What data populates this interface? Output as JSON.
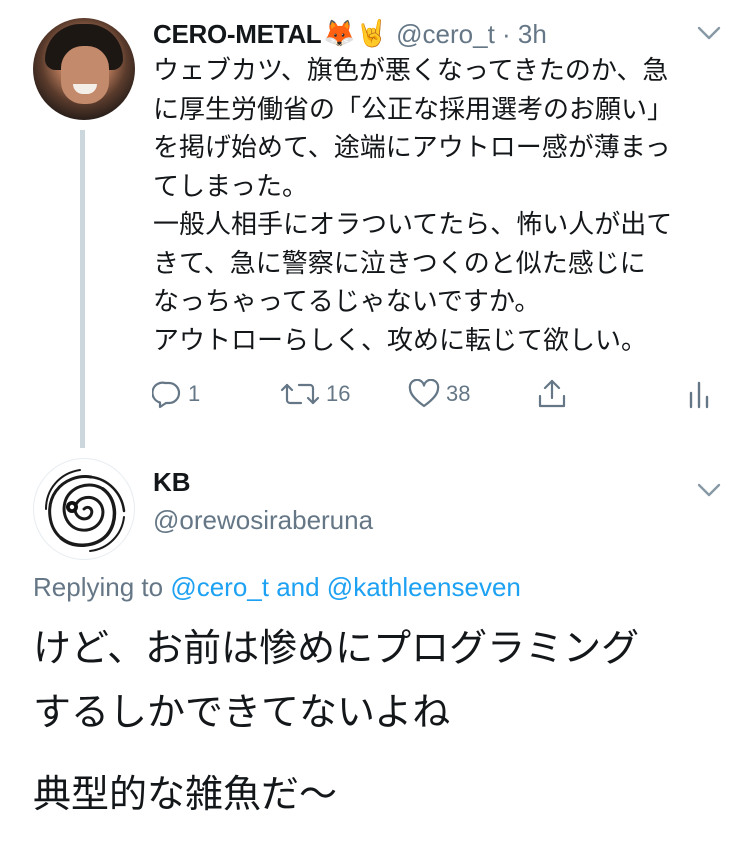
{
  "parent_tweet": {
    "display_name": "CERO-METAL",
    "name_emoji": "🦊🤘",
    "handle_time": "@cero_t · 3h",
    "text_lines": [
      "ウェブカツ、旗色が悪くなってきたのか、急",
      "に厚生労働省の「公正な採用選考のお願い」",
      "を掲げ始めて、途端にアウトロー感が薄まっ",
      "てしまった。",
      "一般人相手にオラついてたら、怖い人が出て",
      "きて、急に警察に泣きつくのと似た感じに",
      "なっちゃってるじゃないですか。",
      "アウトローらしく、攻めに転じて欲しい。"
    ],
    "reply_count": "1",
    "retweet_count": "16",
    "like_count": "38"
  },
  "reply_tweet": {
    "display_name": "KB",
    "handle": "@orewosiraberuna",
    "replying_prefix": "Replying to ",
    "replying_mention_1": "@cero_t",
    "replying_and": " and ",
    "replying_mention_2": "@kathleenseven",
    "text_line_1": "けど、お前は惨めにプログラミング",
    "text_line_2": "するしかできてないよね",
    "text_line_3": "典型的な雑魚だ〜"
  },
  "colors": {
    "text": "#14171a",
    "secondary": "#657786",
    "link": "#1da1f2",
    "thread_line": "#ccd6dd"
  },
  "icons": [
    "reply-icon",
    "retweet-icon",
    "like-icon",
    "share-icon",
    "analytics-icon",
    "chevron-down-icon"
  ]
}
